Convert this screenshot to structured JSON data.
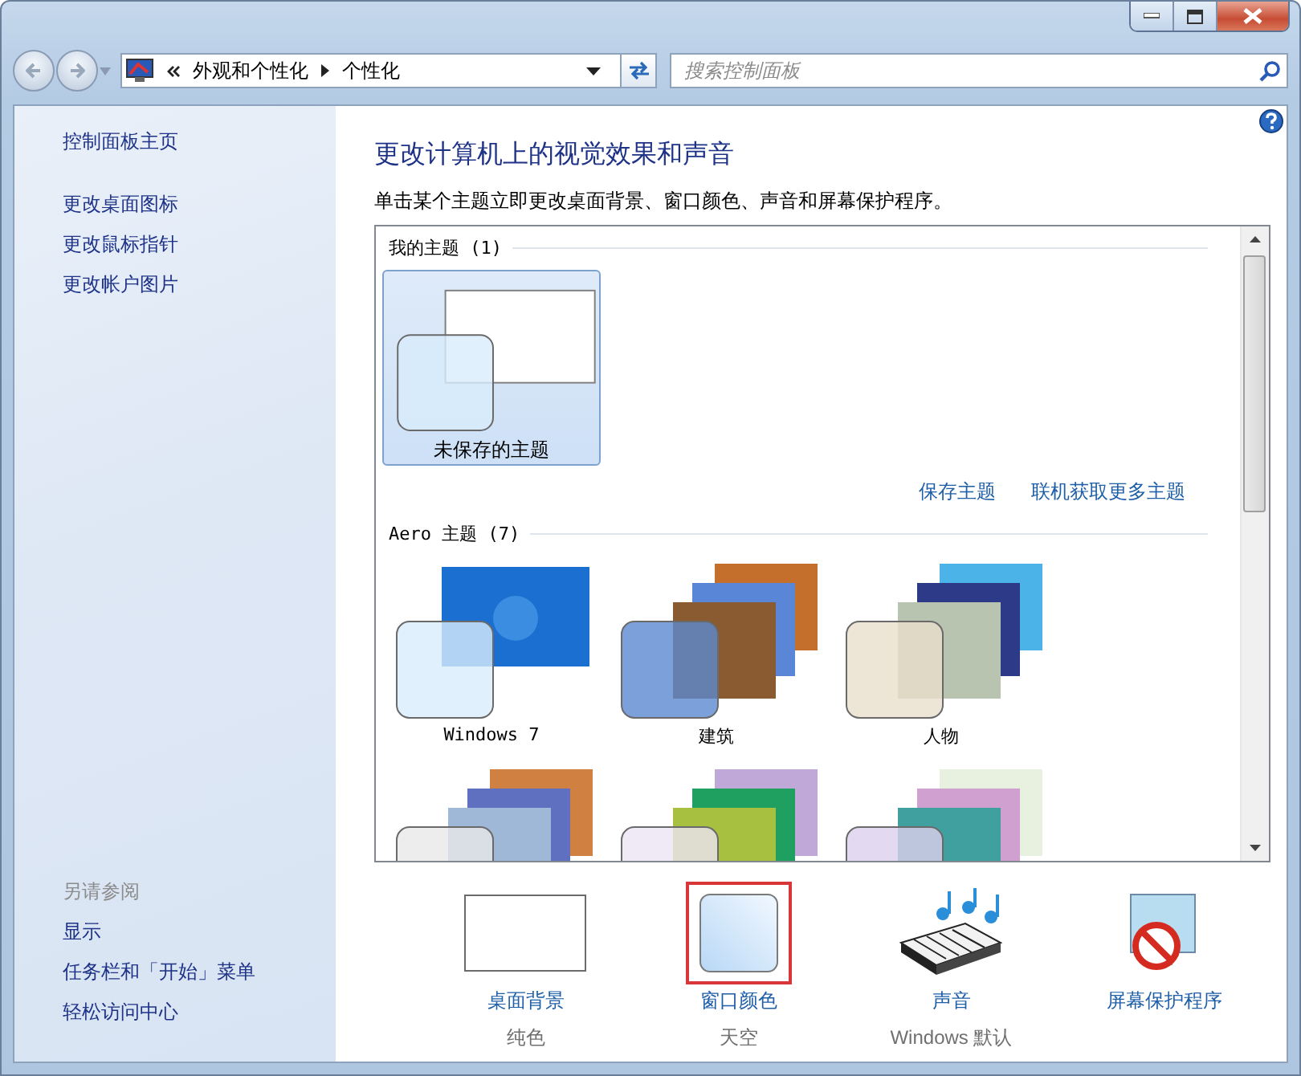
{
  "address": {
    "crumbs": [
      "外观和个性化",
      "个性化"
    ]
  },
  "search": {
    "placeholder": "搜索控制面板"
  },
  "sidebar": {
    "items": [
      "控制面板主页",
      "更改桌面图标",
      "更改鼠标指针",
      "更改帐户图片"
    ],
    "see_also": {
      "title": "另请参阅",
      "items": [
        "显示",
        "任务栏和「开始」菜单",
        "轻松访问中心"
      ]
    }
  },
  "heading": "更改计算机上的视觉效果和声音",
  "description": "单击某个主题立即更改桌面背景、窗口颜色、声音和屏幕保护程序。",
  "groups": [
    {
      "title": "我的主题 (1)",
      "themes": [
        {
          "name": "未保存的主题",
          "kind": "blank",
          "selected": true
        }
      ],
      "links": [
        "保存主题",
        "联机获取更多主题"
      ]
    },
    {
      "title": "Aero 主题 (7)",
      "themes": [
        {
          "name": "Windows 7",
          "kind": "single",
          "selected": false
        },
        {
          "name": "建筑",
          "kind": "stack",
          "selected": false
        },
        {
          "name": "人物",
          "kind": "stack",
          "selected": false
        },
        {
          "kind": "stack",
          "selected": false
        },
        {
          "kind": "stack",
          "selected": false
        },
        {
          "kind": "stack",
          "selected": false
        }
      ]
    }
  ],
  "settings": [
    {
      "kind": "background",
      "label": "桌面背景",
      "value": "纯色",
      "highlighted": false
    },
    {
      "kind": "color",
      "label": "窗口颜色",
      "value": "天空",
      "highlighted": true
    },
    {
      "kind": "sound",
      "label": "声音",
      "value": "Windows 默认",
      "highlighted": false
    },
    {
      "kind": "screensaver",
      "label": "屏幕保护程序",
      "highlighted": false
    }
  ]
}
